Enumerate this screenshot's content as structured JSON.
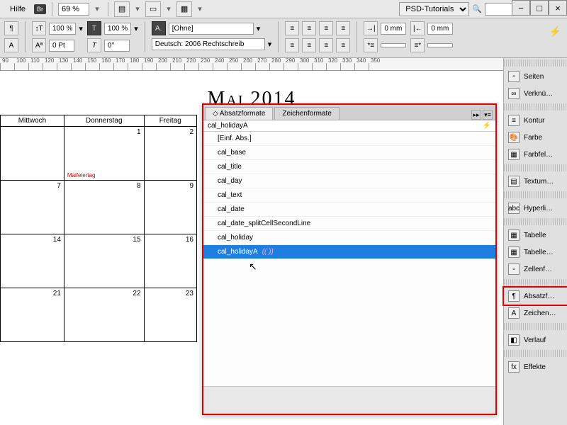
{
  "menubar": {
    "help": "Hilfe",
    "bridge_badge": "Br",
    "zoom": "69 %",
    "psd_label": "PSD-Tutorials"
  },
  "win": {
    "min": "−",
    "max": "□",
    "close": "×"
  },
  "toolbar": {
    "size1": "100 %",
    "size2": "100 %",
    "pt": "0 Pt",
    "deg": "0°",
    "charstyle": "[Ohne]",
    "lang": "Deutsch: 2006 Rechtschreib",
    "mm1": "0 mm",
    "mm2": "0 mm"
  },
  "ruler_ticks": [
    "90",
    "100",
    "110",
    "120",
    "130",
    "140",
    "150",
    "160",
    "170",
    "180",
    "190",
    "200",
    "210",
    "220",
    "230",
    "240",
    "250",
    "260",
    "270",
    "280",
    "290",
    "300",
    "310",
    "320",
    "330",
    "340",
    "350"
  ],
  "calendar": {
    "title": "Mai 2014",
    "days": [
      "Mittwoch",
      "Donnerstag",
      "Freitag"
    ],
    "cells": [
      [
        "",
        "1",
        "2"
      ],
      [
        "7",
        "8",
        "9"
      ],
      [
        "14",
        "15",
        "16"
      ],
      [
        "21",
        "22",
        "23"
      ]
    ],
    "holiday_label": "Maifeiertag"
  },
  "panel": {
    "tab1": "Absatzformate",
    "tab2": "Zeichenformate",
    "filter": "cal_holidayA",
    "styles": [
      "[Einf. Abs.]",
      "cal_base",
      "cal_title",
      "cal_day",
      "cal_text",
      "cal_date",
      "cal_date_splitCellSecondLine",
      "cal_holiday",
      "cal_holidayA"
    ],
    "selected_markers": "((   ))"
  },
  "right_panel": {
    "items": [
      {
        "label": "Seiten",
        "icon": "▫"
      },
      {
        "label": "Verknü…",
        "icon": "∞"
      },
      {
        "label": "Kontur",
        "icon": "≡"
      },
      {
        "label": "Farbe",
        "icon": "🎨"
      },
      {
        "label": "Farbfel…",
        "icon": "▦"
      },
      {
        "label": "Textum…",
        "icon": "▤"
      },
      {
        "label": "Hyperli…",
        "icon": "abc"
      },
      {
        "label": "Tabelle",
        "icon": "▦"
      },
      {
        "label": "Tabelle…",
        "icon": "▦"
      },
      {
        "label": "Zellenf…",
        "icon": "▫"
      },
      {
        "label": "Absatzf…",
        "icon": "¶"
      },
      {
        "label": "Zeichen…",
        "icon": "A"
      },
      {
        "label": "Verlauf",
        "icon": "◧"
      },
      {
        "label": "Effekte",
        "icon": "fx"
      }
    ],
    "highlight_index": 10
  }
}
